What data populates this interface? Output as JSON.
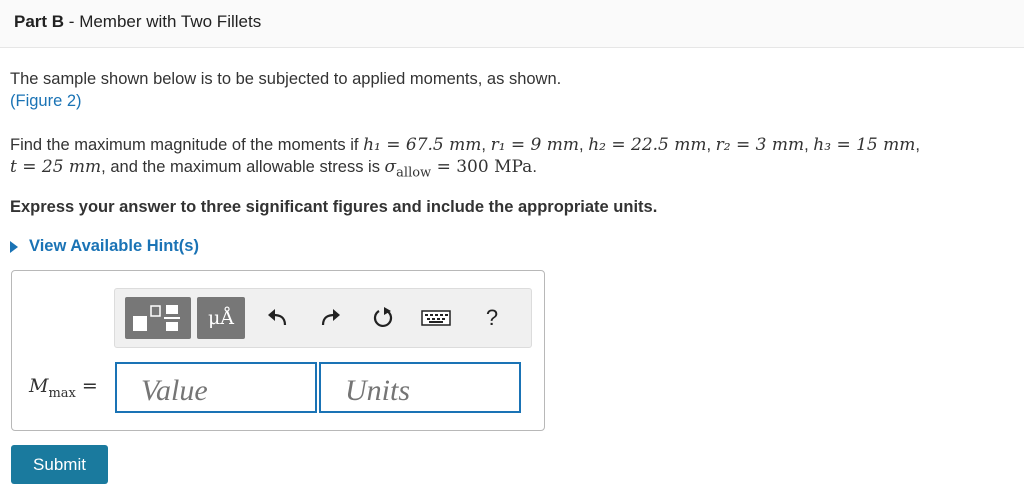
{
  "header": {
    "part_label": "Part B",
    "separator": " - ",
    "title": "Member with Two Fillets"
  },
  "intro": {
    "text": "The sample shown below is to be subjected to applied moments, as shown.",
    "figure_link": "(Figure 2)"
  },
  "problem": {
    "lead": "Find the maximum magnitude of the moments if ",
    "h1": "h₁ = 67.5 mm",
    "r1": "r₁ = 9 mm",
    "h2": "h₂ = 22.5 mm",
    "r2": "r₂ = 3 mm",
    "h3": "h₃ = 15 mm",
    "t": "t = 25 mm",
    "mid": ", and the maximum allowable stress is ",
    "sigma": "σ",
    "sigma_sub": "allow",
    "sigma_val": " = 300 MPa",
    "end": "."
  },
  "instruction": "Express your answer to three significant figures and include the appropriate units.",
  "hint": {
    "label": "View Available Hint(s)"
  },
  "toolbar": {
    "units_label": "μÅ",
    "help_label": "?"
  },
  "answer": {
    "label_main": "M",
    "label_sub": "max",
    "label_eq": " =",
    "value_placeholder": "Value",
    "units_placeholder": "Units"
  },
  "submit_label": "Submit",
  "colors": {
    "link": "#1a73b5",
    "submit_bg": "#1a7a9e",
    "toolbar_dark": "#777777"
  }
}
